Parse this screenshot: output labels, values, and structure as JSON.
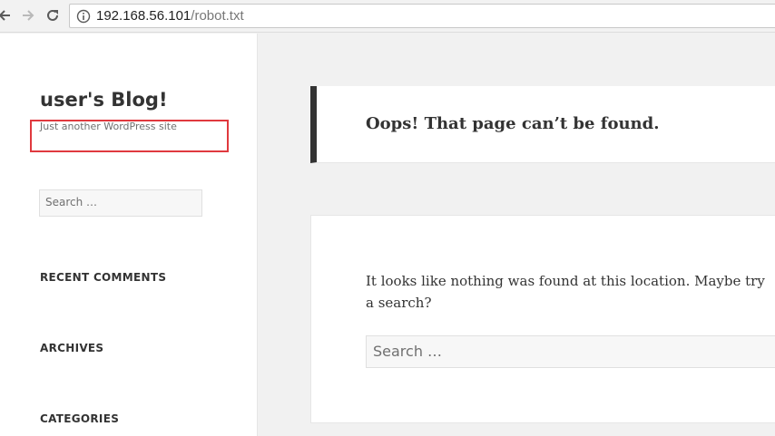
{
  "browser": {
    "url_host": "192.168.56.101",
    "url_path": "/robot.txt"
  },
  "sidebar": {
    "site_title": "user's Blog!",
    "site_description": "Just another WordPress site",
    "search_placeholder": "Search …",
    "widgets": [
      "RECENT COMMENTS",
      "ARCHIVES",
      "CATEGORIES"
    ]
  },
  "main": {
    "page_title": "Oops! That page can’t be found.",
    "message": "It looks like nothing was found at this location. Maybe try a search?",
    "search_placeholder": "Search …"
  },
  "colors": {
    "highlight_box": "#e0393e",
    "title_bar": "#333333"
  }
}
